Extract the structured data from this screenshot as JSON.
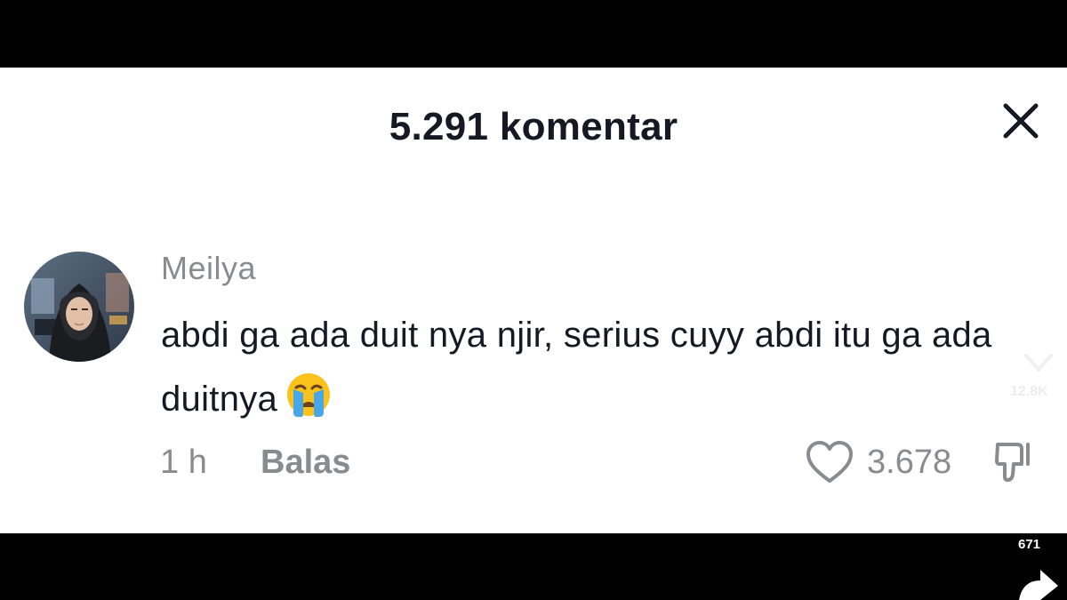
{
  "header": {
    "title": "5.291 komentar",
    "close_icon": "close-icon"
  },
  "comment": {
    "username": "Meilya",
    "text": "abdi ga ada duit nya njir, serius cuyy abdi itu ga ada duitnya",
    "emoji": "loudly-crying-face-emoji",
    "time": "1 h",
    "reply_label": "Balas",
    "like_count": "3.678",
    "like_icon": "heart-icon",
    "dislike_icon": "thumbs-down-icon"
  },
  "background_overlay": {
    "count_behind": "12.8K",
    "share_count": "671",
    "share_icon": "share-arrow-icon"
  },
  "colors": {
    "background": "#000000",
    "panel": "#ffffff",
    "primary_text": "#161823",
    "secondary_text": "#8a8b91"
  }
}
